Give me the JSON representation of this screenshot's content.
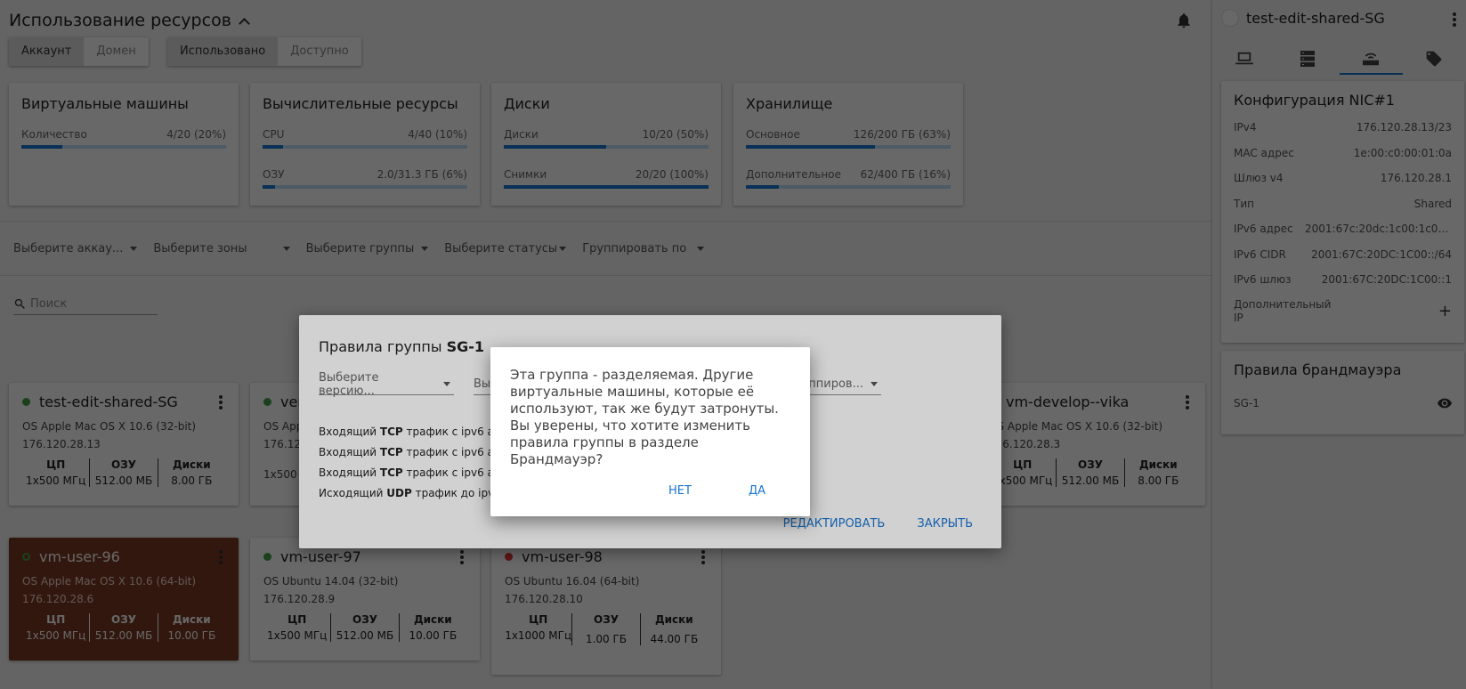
{
  "header": {
    "title": "Использование ресурсов",
    "account_tab": "Аккаунт",
    "domain_tab": "Домен",
    "used_tab": "Использовано",
    "available_tab": "Доступно"
  },
  "stats": [
    {
      "title": "Виртуальные машины",
      "rows": [
        {
          "label": "Количество",
          "value": "4/20 (20%)",
          "percent": 20
        }
      ]
    },
    {
      "title": "Вычислительные ресурсы",
      "rows": [
        {
          "label": "CPU",
          "value": "4/40 (10%)",
          "percent": 10
        },
        {
          "label": "ОЗУ",
          "value": "2.0/31.3 ГБ (6%)",
          "percent": 6
        }
      ]
    },
    {
      "title": "Диски",
      "rows": [
        {
          "label": "Диски",
          "value": "10/20 (50%)",
          "percent": 50
        },
        {
          "label": "Снимки",
          "value": "20/20 (100%)",
          "percent": 100
        }
      ]
    },
    {
      "title": "Хранилище",
      "rows": [
        {
          "label": "Основное",
          "value": "126/200 ГБ (63%)",
          "percent": 63
        },
        {
          "label": "Дополнительное",
          "value": "62/400 ГБ (16%)",
          "percent": 16
        }
      ]
    }
  ],
  "filters": {
    "account": "Выберите аккау...",
    "zones": "Выберите зоны",
    "groups": "Выберите группы",
    "statuses": "Выберите статусы",
    "group_by": "Группировать по"
  },
  "search": {
    "placeholder": "Поиск"
  },
  "vms": [
    {
      "name": "test-edit-shared-SG",
      "os": "OS Apple Mac OS X 10.6 (32-bit)",
      "ip": "176.120.28.13",
      "cpu": "1x500 МГц",
      "ram": "512.00 МБ",
      "disk": "8.00 ГБ",
      "status": "green"
    },
    {
      "name": "veryl",
      "os": "OS App",
      "ip": "176.12",
      "cpu": "1x500",
      "ram": "",
      "disk": "",
      "status": "green"
    },
    {
      "name": "vm-develop--vika",
      "os": "OS Apple Mac OS X 10.6 (32-bit)",
      "ip": "176.120.28.3",
      "cpu": "1x500 МГц",
      "ram": "512.00 МБ",
      "disk": "8.00 ГБ",
      "status": "green"
    },
    {
      "name": "vm-user-96",
      "os": "OS Apple Mac OS X 10.6 (64-bit)",
      "ip": "176.120.28.6",
      "cpu": "1x500 МГц",
      "ram": "512.00 МБ",
      "disk": "10.00 ГБ",
      "status": "green-outline"
    },
    {
      "name": "vm-user-97",
      "os": "OS Ubuntu 14.04 (32-bit)",
      "ip": "176.120.28.9",
      "cpu": "1x500 МГц",
      "ram": "512.00 МБ",
      "disk": "10.00 ГБ",
      "status": "green"
    },
    {
      "name": "vm-user-98",
      "os": "OS Ubuntu 16.04 (64-bit)",
      "ip": "176.120.28.10",
      "cpu": "1x1000 МГц",
      "ram": "1.00 ГБ",
      "disk": "44.00 ГБ",
      "status": "red"
    }
  ],
  "spec_labels": {
    "cpu": "ЦП",
    "ram": "ОЗУ",
    "disk": "Диски"
  },
  "sidebar": {
    "title": "test-edit-shared-SG",
    "nic_title": "Конфигурация NIC#1",
    "nic": [
      {
        "k": "IPv4",
        "v": "176.120.28.13/23"
      },
      {
        "k": "MAC адрес",
        "v": "1e:00:c0:00:01:0a"
      },
      {
        "k": "Шлюз v4",
        "v": "176.120.28.1"
      },
      {
        "k": "Тип",
        "v": "Shared"
      },
      {
        "k": "IPv6 адрес",
        "v": "2001:67c:20dc:1c00:1c00..."
      },
      {
        "k": "IPv6 CIDR",
        "v": "2001:67C:20DC:1C00::/64"
      },
      {
        "k": "IPv6 шлюз",
        "v": "2001:67C:20DC:1C00::1"
      }
    ],
    "extra_ip_label": "Дополнительный IP",
    "firewall_title": "Правила брандмауэра",
    "firewall_item": "SG-1"
  },
  "rules_dialog": {
    "title_prefix": "Правила группы",
    "title_group": "SG-1",
    "select_version": "Выберите версию...",
    "select_type": "Вы",
    "select_group": "ппиров...",
    "rules": [
      {
        "dir": "Входящий",
        "proto": "TCP",
        "rest": "трафик с ipv6 a"
      },
      {
        "dir": "Входящий",
        "proto": "TCP",
        "rest": "трафик с ipv6 a"
      },
      {
        "dir": "Входящий",
        "proto": "TCP",
        "rest": "трафик с ipv6 a"
      },
      {
        "dir": "Исходящий",
        "proto": "UDP",
        "rest": "трафик до ipv"
      }
    ],
    "edit": "РЕДАКТИРОВАТЬ",
    "close": "ЗАКРЫТЬ"
  },
  "confirm": {
    "message": "Эта группа - разделяемая. Другие виртуальные машины, которые её используют, так же будут затронуты. Вы уверены, что хотите изменить правила группы в разделе Брандмауэр?",
    "no": "НЕТ",
    "yes": "ДА"
  },
  "colors": {
    "accent": "#1976d2",
    "selected_card": "#7b3a24",
    "status_green": "#43a047",
    "status_red": "#e53935"
  }
}
